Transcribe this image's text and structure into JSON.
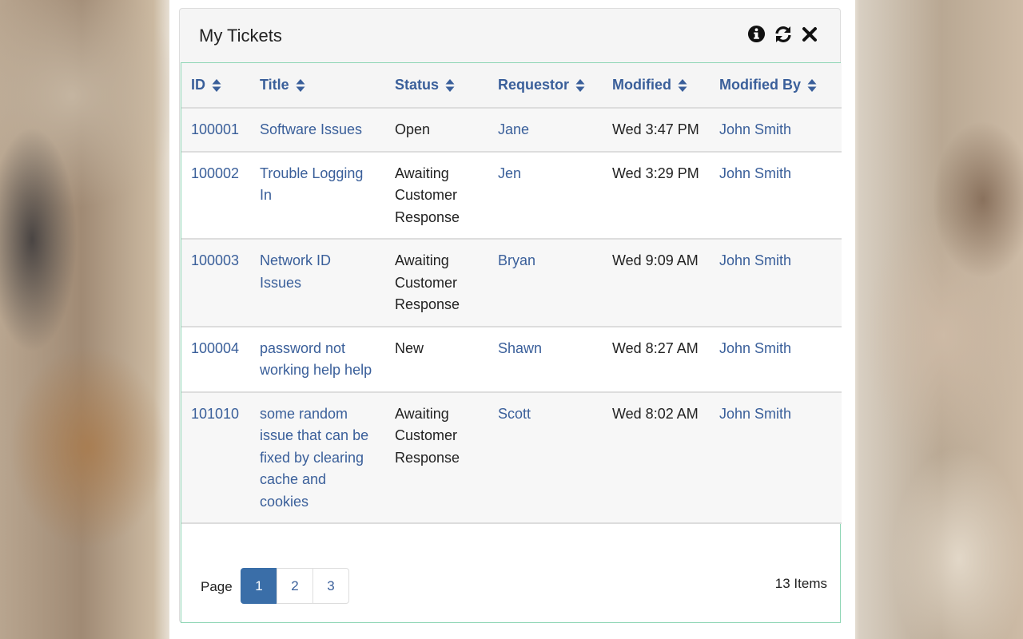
{
  "panel": {
    "title": "My Tickets",
    "tools": [
      "info-icon",
      "refresh-icon",
      "close-icon"
    ]
  },
  "columns": [
    "ID",
    "Title",
    "Status",
    "Requestor",
    "Modified",
    "Modified By"
  ],
  "rows": [
    {
      "id": "100001",
      "title": "Software Issues",
      "status": "Open",
      "requestor": "Jane",
      "modified": "Wed 3:47 PM",
      "modified_by": "John Smith"
    },
    {
      "id": "100002",
      "title": "Trouble Logging In",
      "status": "Awaiting Customer Response",
      "requestor": "Jen",
      "modified": "Wed 3:29 PM",
      "modified_by": "John Smith"
    },
    {
      "id": "100003",
      "title": "Network ID Issues",
      "status": "Awaiting Customer Response",
      "requestor": "Bryan",
      "modified": "Wed 9:09 AM",
      "modified_by": "John Smith"
    },
    {
      "id": "100004",
      "title": "password not working help help",
      "status": "New",
      "requestor": "Shawn",
      "modified": "Wed 8:27 AM",
      "modified_by": "John Smith"
    },
    {
      "id": "101010",
      "title": "some random issue that can be fixed by clearing cache and cookies",
      "status": "Awaiting Customer Response",
      "requestor": "Scott",
      "modified": "Wed 8:02 AM",
      "modified_by": "John Smith"
    }
  ],
  "pager": {
    "label": "Page",
    "pages": [
      "1",
      "2",
      "3"
    ],
    "current": "1",
    "count": "13 Items"
  },
  "colors": {
    "link": "#3a5f9a",
    "active_page": "#3a6ea8",
    "grid_border": "#8fd6b5"
  }
}
